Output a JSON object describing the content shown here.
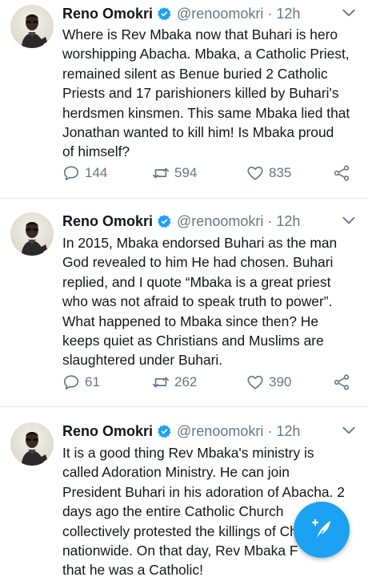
{
  "tweets": [
    {
      "name": "Reno Omokri",
      "handle": "@renoomokri · 12h",
      "text": "Where is Rev Mbaka now that Buhari is hero\nworshipping Abacha. Mbaka, a Catholic Priest,\nremained silent as Benue buried 2 Catholic\nPriests and 17 parishioners killed by Buhari's\nherdsmen kinsmen. This same Mbaka lied that\nJonathan wanted to kill him! Is Mbaka proud\nof himself?",
      "replies": "144",
      "retweets": "594",
      "likes": "835"
    },
    {
      "name": "Reno Omokri",
      "handle": "@renoomokri · 12h",
      "text": "In 2015, Mbaka endorsed Buhari as the man\nGod revealed to him He had chosen. Buhari\nreplied, and I quote “Mbaka is a great priest\nwho was not afraid to speak truth to power”.\nWhat happened to Mbaka since then? He\nkeeps quiet as Christians and Muslims are\nslaughtered under Buhari.",
      "replies": "61",
      "retweets": "262",
      "likes": "390"
    },
    {
      "name": "Reno Omokri",
      "handle": "@renoomokri · 12h",
      "text": "It is a good thing Rev Mbaka's ministry is\ncalled Adoration Ministry. He can join\nPresident Buhari in his adoration of Abacha. 2\ndays ago the entire Catholic Church\ncollectively protested the killings of Christians\nnationwide. On that day, Rev Mbaka F\nthat he was a Catholic!"
    }
  ],
  "colors": {
    "accent": "#1da1f2",
    "muted": "#657786",
    "text": "#14171a",
    "divider": "#e1e8ed"
  },
  "icons": {
    "verified": "verified-badge-icon",
    "caret": "chevron-down-icon",
    "reply": "reply-icon",
    "retweet": "retweet-icon",
    "like": "heart-icon",
    "share": "share-icon",
    "compose": "compose-tweet-icon"
  }
}
